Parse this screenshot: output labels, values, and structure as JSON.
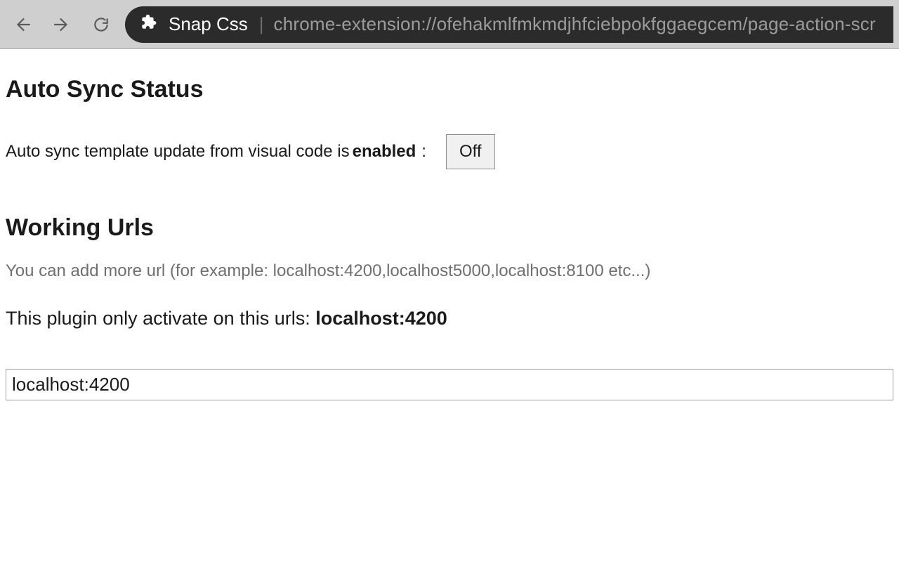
{
  "chrome": {
    "extension_name": "Snap Css",
    "url": "chrome-extension://ofehakmlfmkmdjhfciebpokfggaegcem/page-action-scr"
  },
  "sync": {
    "heading": "Auto Sync Status",
    "lead_text": "Auto sync template update from visual code is ",
    "state_word": "enabled",
    "colon": ":",
    "toggle_label": "Off"
  },
  "urls": {
    "heading": "Working Urls",
    "hint": "You can add more url (for example: localhost:4200,localhost5000,localhost:8100 etc...)",
    "activate_prefix": "This plugin only activate on this urls: ",
    "active_host": "localhost:4200",
    "input_value": "localhost:4200"
  }
}
